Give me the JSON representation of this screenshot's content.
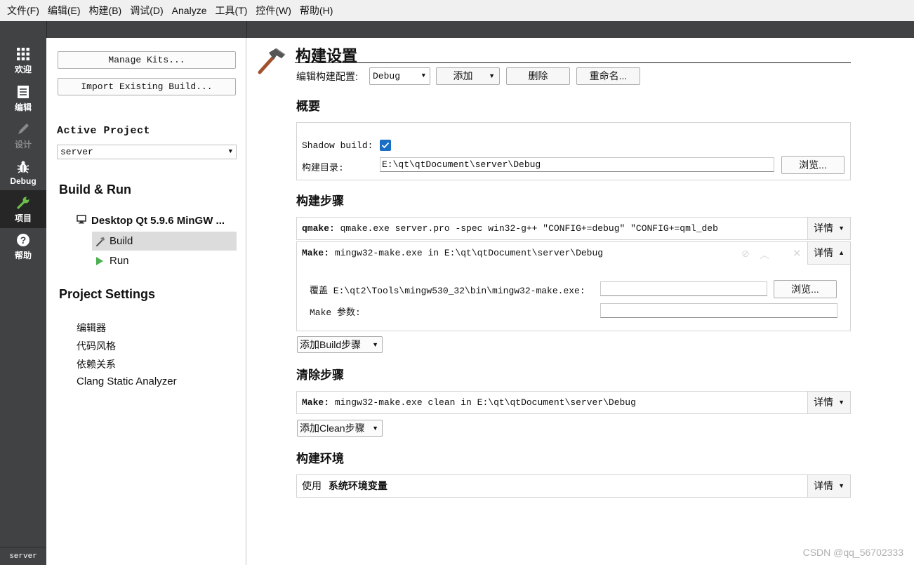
{
  "menu": [
    "文件(F)",
    "编辑(E)",
    "构建(B)",
    "调试(D)",
    "Analyze",
    "工具(T)",
    "控件(W)",
    "帮助(H)"
  ],
  "modes": {
    "welcome": "欢迎",
    "edit": "编辑",
    "design": "设计",
    "debug": "Debug",
    "projects": "项目",
    "help": "帮助",
    "server": "server"
  },
  "nav": {
    "manage_kits": "Manage Kits...",
    "import_build": "Import Existing Build...",
    "active_project_label": "Active Project",
    "active_project": "server",
    "build_run_heading": "Build & Run",
    "kit_name": "Desktop Qt 5.9.6 MinGW ...",
    "build_item": "Build",
    "run_item": "Run",
    "project_settings_heading": "Project Settings",
    "settings_items": [
      "编辑器",
      "代码风格",
      "依赖关系",
      "Clang Static Analyzer"
    ]
  },
  "main": {
    "title": "构建设置",
    "edit_config_label": "编辑构建配置:",
    "config_value": "Debug",
    "add_label": "添加",
    "delete_label": "删除",
    "rename_label": "重命名...",
    "overview_heading": "概要",
    "shadow_build_label": "Shadow build:",
    "shadow_build_checked": true,
    "build_dir_label": "构建目录:",
    "build_dir_value": "E:\\qt\\qtDocument\\server\\Debug",
    "browse_label": "浏览...",
    "build_steps_heading": "构建步骤",
    "qmake_prefix": "qmake:",
    "qmake_cmd": "qmake.exe server.pro -spec win32-g++ \"CONFIG+=debug\" \"CONFIG+=qml_deb",
    "make_prefix": "Make:",
    "make_cmd": "mingw32-make.exe in E:\\qt\\qtDocument\\server\\Debug",
    "details_label": "详情",
    "override_label": "覆盖 E:\\qt2\\Tools\\mingw530_32\\bin\\mingw32-make.exe:",
    "make_args_label": "Make 参数:",
    "override_value": "",
    "make_args_value": "",
    "add_build_step": "添加Build步骤",
    "clean_steps_heading": "清除步骤",
    "clean_cmd": "mingw32-make.exe clean in E:\\qt\\qtDocument\\server\\Debug",
    "add_clean_step": "添加Clean步骤",
    "build_env_heading": "构建环境",
    "env_use": "使用",
    "env_value": "系统环境变量"
  },
  "watermark": "CSDN @qq_56702333",
  "colors": {
    "mode_bar": "#404244",
    "active_mode": "#262626",
    "projects_icon": "#6cc04a",
    "run_icon": "#4caf50",
    "checkbox": "#1a6fc4"
  }
}
